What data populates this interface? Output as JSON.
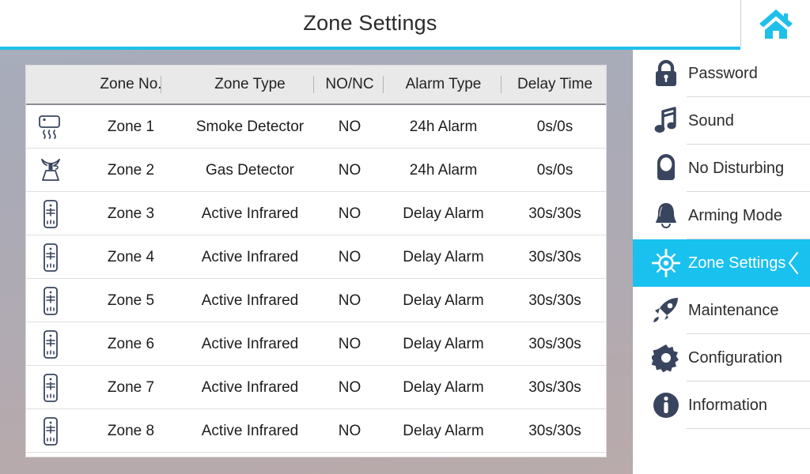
{
  "header": {
    "title": "Zone Settings",
    "home_icon": "home-icon",
    "accent_color": "#1fc0ea"
  },
  "table": {
    "columns": [
      "Zone No.",
      "Zone Type",
      "NO/NC",
      "Alarm Type",
      "Delay Time"
    ],
    "rows": [
      {
        "icon": "smoke-detector-icon",
        "zone_no": "Zone 1",
        "zone_type": "Smoke Detector",
        "no_nc": "NO",
        "alarm_type": "24h Alarm",
        "delay_time": "0s/0s"
      },
      {
        "icon": "gas-detector-icon",
        "zone_no": "Zone 2",
        "zone_type": "Gas Detector",
        "no_nc": "NO",
        "alarm_type": "24h Alarm",
        "delay_time": "0s/0s"
      },
      {
        "icon": "infrared-detector-icon",
        "zone_no": "Zone 3",
        "zone_type": "Active Infrared",
        "no_nc": "NO",
        "alarm_type": "Delay Alarm",
        "delay_time": "30s/30s"
      },
      {
        "icon": "infrared-detector-icon",
        "zone_no": "Zone 4",
        "zone_type": "Active Infrared",
        "no_nc": "NO",
        "alarm_type": "Delay Alarm",
        "delay_time": "30s/30s"
      },
      {
        "icon": "infrared-detector-icon",
        "zone_no": "Zone 5",
        "zone_type": "Active Infrared",
        "no_nc": "NO",
        "alarm_type": "Delay Alarm",
        "delay_time": "30s/30s"
      },
      {
        "icon": "infrared-detector-icon",
        "zone_no": "Zone 6",
        "zone_type": "Active Infrared",
        "no_nc": "NO",
        "alarm_type": "Delay Alarm",
        "delay_time": "30s/30s"
      },
      {
        "icon": "infrared-detector-icon",
        "zone_no": "Zone 7",
        "zone_type": "Active Infrared",
        "no_nc": "NO",
        "alarm_type": "Delay Alarm",
        "delay_time": "30s/30s"
      },
      {
        "icon": "infrared-detector-icon",
        "zone_no": "Zone 8",
        "zone_type": "Active Infrared",
        "no_nc": "NO",
        "alarm_type": "Delay Alarm",
        "delay_time": "30s/30s"
      }
    ]
  },
  "sidebar": {
    "highlight_color": "#19c1ef",
    "items": [
      {
        "label": "Password",
        "icon": "lock-icon",
        "active": false
      },
      {
        "label": "Sound",
        "icon": "music-note-icon",
        "active": false
      },
      {
        "label": "No Disturbing",
        "icon": "do-not-disturb-icon",
        "active": false
      },
      {
        "label": "Arming Mode",
        "icon": "bell-icon",
        "active": false
      },
      {
        "label": "Zone Settings",
        "icon": "crosshair-icon",
        "active": true,
        "chevron": "chevron-left-icon"
      },
      {
        "label": "Maintenance",
        "icon": "rocket-icon",
        "active": false
      },
      {
        "label": "Configuration",
        "icon": "gear-icon",
        "active": false
      },
      {
        "label": "Information",
        "icon": "info-icon",
        "active": false
      }
    ]
  }
}
